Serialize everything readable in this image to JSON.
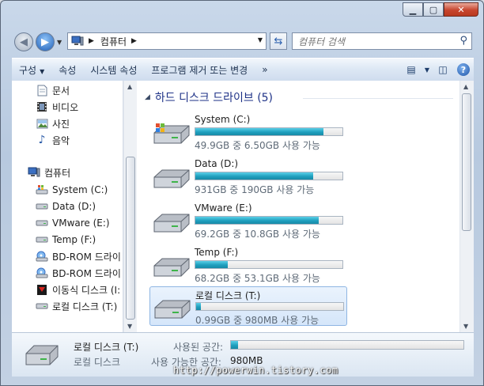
{
  "address": {
    "crumb": "컴퓨터"
  },
  "search": {
    "placeholder": "컴퓨터 검색"
  },
  "toolbar": {
    "organize": "구성",
    "properties": "속성",
    "system_properties": "시스템 속성",
    "uninstall": "프로그램 제거 또는 변경",
    "more": "»"
  },
  "sidebar": {
    "items": [
      {
        "label": "문서",
        "icon": "document-icon"
      },
      {
        "label": "비디오",
        "icon": "video-icon"
      },
      {
        "label": "사진",
        "icon": "picture-icon"
      },
      {
        "label": "음악",
        "icon": "music-icon"
      },
      {
        "label": "컴퓨터",
        "icon": "computer-icon"
      },
      {
        "label": "System (C:)",
        "icon": "windows-drive-icon"
      },
      {
        "label": "Data (D:)",
        "icon": "drive-icon"
      },
      {
        "label": "VMware (E:)",
        "icon": "drive-icon"
      },
      {
        "label": "Temp (F:)",
        "icon": "drive-icon"
      },
      {
        "label": "BD-ROM 드라이",
        "icon": "bd-rom-icon"
      },
      {
        "label": "BD-ROM 드라이",
        "icon": "bd-rom-icon"
      },
      {
        "label": "이동식 디스크 (I:",
        "icon": "removable-disk-icon"
      },
      {
        "label": "로컬 디스크 (T:)",
        "icon": "drive-icon"
      }
    ]
  },
  "main": {
    "group_title": "하드 디스크 드라이브 (5)",
    "drives": [
      {
        "name": "System (C:)",
        "info": "49.9GB 중 6.50GB 사용 가능",
        "used_fraction": 0.87,
        "selected": false
      },
      {
        "name": "Data (D:)",
        "info": "931GB 중 190GB 사용 가능",
        "used_fraction": 0.8,
        "selected": false
      },
      {
        "name": "VMware (E:)",
        "info": "69.2GB 중 10.8GB 사용 가능",
        "used_fraction": 0.84,
        "selected": false
      },
      {
        "name": "Temp (F:)",
        "info": "68.2GB 중 53.1GB 사용 가능",
        "used_fraction": 0.22,
        "selected": false
      },
      {
        "name": "로컬 디스크 (T:)",
        "info": "0.99GB 중 980MB 사용 가능",
        "used_fraction": 0.03,
        "selected": true
      }
    ]
  },
  "details": {
    "title": "로컬 디스크 (T:)",
    "type": "로컬 디스크",
    "used_label": "사용된 공간:",
    "free_label": "사용 가능한 공간:",
    "free_value": "980MB",
    "used_fraction": 0.03
  },
  "watermark": "http://powerwin.tistory.com",
  "colors": {
    "bar_fill": "#1f9fbe",
    "selection": "#d5e6fa",
    "group_header": "#1e3287"
  }
}
